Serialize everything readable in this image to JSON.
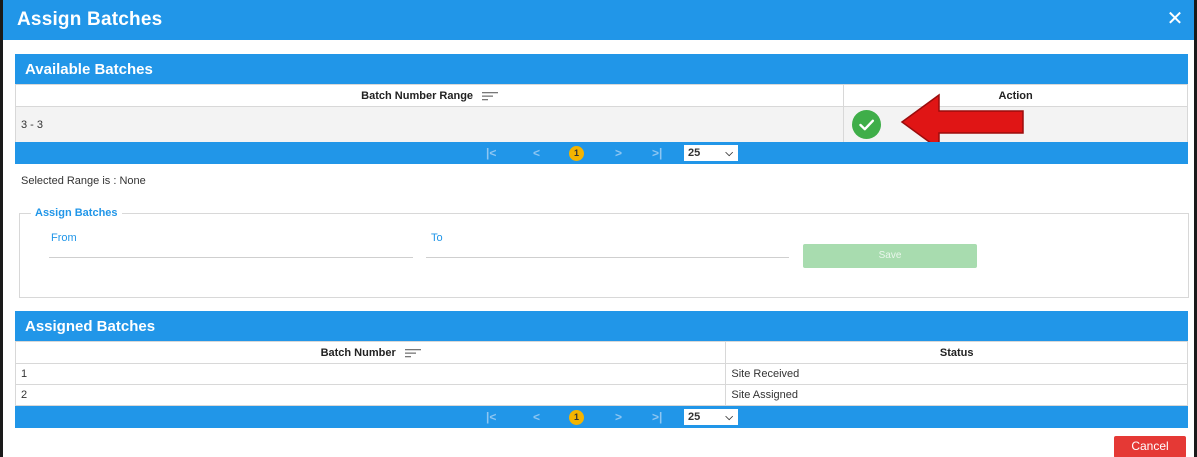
{
  "dialog": {
    "title": "Assign Batches",
    "close_glyph": "✕"
  },
  "available": {
    "header": "Available Batches",
    "columns": [
      "Batch Number Range",
      "Action"
    ],
    "rows": [
      {
        "range": "3 - 3"
      }
    ]
  },
  "pager_top": {
    "first": "|<",
    "prev": "<",
    "page": "1",
    "next": ">",
    "last": ">|",
    "page_size": "25"
  },
  "selected_range": "Selected Range is : None",
  "assign_form": {
    "legend": "Assign Batches",
    "from_label": "From",
    "to_label": "To",
    "save_label": "Save"
  },
  "assigned": {
    "header": "Assigned Batches",
    "columns": [
      "Batch Number",
      "Status"
    ],
    "rows": [
      {
        "number": "1",
        "status": "Site Received"
      },
      {
        "number": "2",
        "status": "Site Assigned"
      }
    ]
  },
  "pager_bottom": {
    "first": "|<",
    "prev": "<",
    "page": "1",
    "next": ">",
    "last": ">|",
    "page_size": "25"
  },
  "cancel_label": "Cancel",
  "colors": {
    "primary": "#2196e8",
    "success": "#3fae49",
    "danger": "#e53935",
    "page_badge": "#f4b400",
    "annotation_arrow": "#e01515"
  },
  "icons": {
    "close": "close-icon",
    "sort": "sort-icon",
    "check": "check-icon",
    "dropdown": "chevron-down-icon",
    "annotation": "red-arrow-annotation"
  }
}
